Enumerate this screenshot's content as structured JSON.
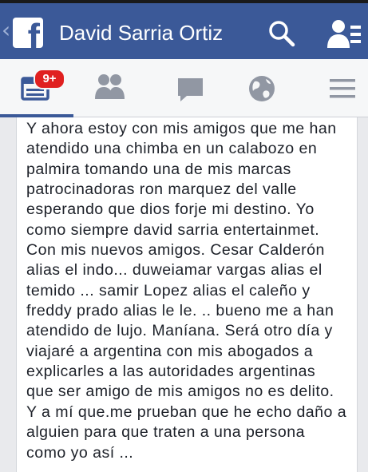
{
  "header": {
    "back_glyph": "‹",
    "logo_letter": "f",
    "title": "David Sarria Ortiz",
    "search_icon": "search-icon",
    "friends_icon": "friend-requests-icon",
    "color": "#3b5998"
  },
  "tabs": {
    "news_feed": {
      "icon": "news-feed-icon",
      "badge": "9+",
      "active": true
    },
    "friends": {
      "icon": "friends-icon"
    },
    "messages": {
      "icon": "messages-icon"
    },
    "notifications": {
      "icon": "globe-icon"
    },
    "more": {
      "icon": "menu-icon"
    }
  },
  "post": {
    "text": "Y ahora estoy con mis amigos que me han\natendido una chimba en un calabozo en\npalmira tomando una de mis marcas\npatrocinadoras ron marquez del valle\nesperando que dios forje mi destino. Yo\ncomo siempre david sarria entertainmet.\nCon mis nuevos amigos. Cesar Calderón\nalias el indo... duweiamar vargas alias el\ntemido ... samir Lopez alias el caleño y\nfreddy prado alias le le. .. bueno me a han\natendido de lujo. Maníana. Será otro día y\nviajaré a argentina con mis abogados a\nexplicarles a las autoridades argentinas\nque ser amigo de mis amigos no es delito.\nY a mí que.me prueban que he echo daño a\nalguien para que traten a una persona\ncomo yo así ..."
  }
}
